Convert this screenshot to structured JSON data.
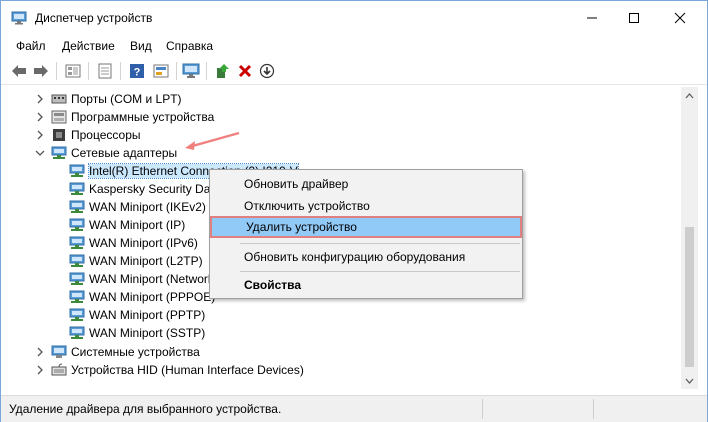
{
  "window": {
    "title": "Диспетчер устройств"
  },
  "menu": [
    "Файл",
    "Действие",
    "Вид",
    "Справка"
  ],
  "tree": [
    {
      "label": "Порты (COM и LPT)",
      "expander": "collapsed",
      "icon": "port-icon"
    },
    {
      "label": "Программные устройства",
      "expander": "collapsed",
      "icon": "software-device-icon"
    },
    {
      "label": "Процессоры",
      "expander": "collapsed",
      "icon": "cpu-icon"
    },
    {
      "label": "Сетевые адаптеры",
      "expander": "expanded",
      "icon": "network-adapter-icon"
    },
    {
      "label": "Intel(R) Ethernet Connection (2) I219-V",
      "icon": "network-adapter-icon",
      "selected": true
    },
    {
      "label": "Kaspersky Security Data Escort Adapter",
      "icon": "network-adapter-icon"
    },
    {
      "label": "WAN Miniport (IKEv2)",
      "icon": "network-adapter-icon"
    },
    {
      "label": "WAN Miniport (IP)",
      "icon": "network-adapter-icon"
    },
    {
      "label": "WAN Miniport (IPv6)",
      "icon": "network-adapter-icon"
    },
    {
      "label": "WAN Miniport (L2TP)",
      "icon": "network-adapter-icon"
    },
    {
      "label": "WAN Miniport (Network Monitor)",
      "icon": "network-adapter-icon"
    },
    {
      "label": "WAN Miniport (PPPOE)",
      "icon": "network-adapter-icon"
    },
    {
      "label": "WAN Miniport (PPTP)",
      "icon": "network-adapter-icon"
    },
    {
      "label": "WAN Miniport (SSTP)",
      "icon": "network-adapter-icon"
    },
    {
      "label": "Системные устройства",
      "expander": "collapsed",
      "icon": "system-device-icon"
    },
    {
      "label": "Устройства HID (Human Interface Devices)",
      "expander": "collapsed",
      "icon": "hid-icon"
    }
  ],
  "context_menu": {
    "update_driver": "Обновить драйвер",
    "disable_device": "Отключить устройство",
    "uninstall_device": "Удалить устройство",
    "scan_hardware": "Обновить конфигурацию оборудования",
    "properties": "Свойства"
  },
  "status": {
    "text": "Удаление драйвера для выбранного устройства."
  },
  "colors": {
    "highlight": "#91c9f7",
    "highlight_border": "#e08080",
    "annotation_arrow": "#f08080",
    "delete_red": "#cc0000"
  }
}
